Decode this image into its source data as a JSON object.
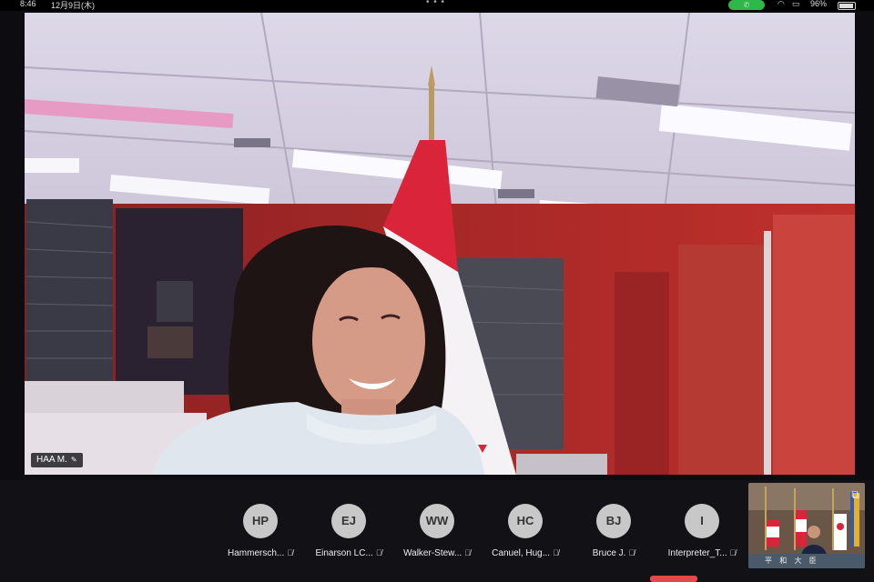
{
  "status_bar": {
    "time": "8:46",
    "date": "12月9日(木)",
    "battery": "96%",
    "call_color": "#2fb84a"
  },
  "main_video": {
    "speaker_name": "HAA M.",
    "pin_icon": "pin-icon"
  },
  "participants": [
    {
      "initials": "HP",
      "name": "Hammersch...",
      "mic": "muted"
    },
    {
      "initials": "EJ",
      "name": "Einarson LC...",
      "mic": "muted"
    },
    {
      "initials": "WW",
      "name": "Walker-Stew...",
      "mic": "muted"
    },
    {
      "initials": "HC",
      "name": "Canuel, Hug...",
      "mic": "muted"
    },
    {
      "initials": "BJ",
      "name": "Bruce J.",
      "mic": "muted"
    },
    {
      "initials": "I",
      "name": "Interpreter_T...",
      "mic": "muted"
    }
  ],
  "self_view": {
    "seal_text": "平 和 大 臣"
  },
  "colors": {
    "flag_red": "#d9243a",
    "wall_red": "#b52a2a",
    "avatar_bg": "#c8c8c8"
  }
}
